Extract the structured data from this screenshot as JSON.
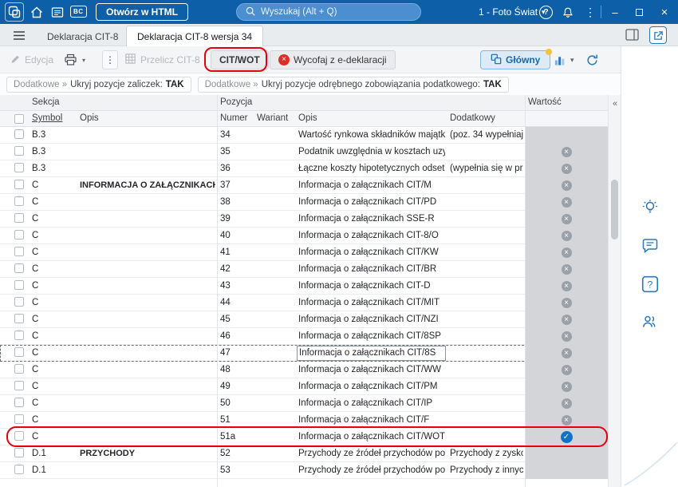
{
  "topbar": {
    "open_html": "Otwórz w HTML",
    "search_placeholder": "Wyszukaj (Alt + Q)",
    "company": "1 - Foto Świat",
    "bc_label": "BC"
  },
  "tabs": {
    "tab1": "Deklaracja CIT-8",
    "tab2": "Deklaracja CIT-8 wersja 34"
  },
  "toolbar": {
    "edit": "Edycja",
    "recalc": "Przelicz CIT-8",
    "citwot": "CIT/WOT",
    "withdraw": "Wycofaj z e-deklaracji",
    "view_main": "Główny"
  },
  "filters": {
    "f1_prefix": "Dodatkowe »",
    "f1_label": "Ukryj pozycje zaliczek:",
    "f1_value": "TAK",
    "f2_prefix": "Dodatkowe »",
    "f2_label": "Ukryj pozycje odrębnego zobowiązania podatkowego:",
    "f2_value": "TAK"
  },
  "icons": {
    "help": "?",
    "more": "⋮",
    "minimize": "–",
    "close": "×",
    "chevron_down": "▾",
    "collapse": "«"
  },
  "grid": {
    "group_sekcja": "Sekcja",
    "group_pozycja": "Pozycja",
    "group_wartosc": "Wartość",
    "col_symbol": "Symbol",
    "col_opis1": "Opis",
    "col_numer": "Numer",
    "col_wariant": "Wariant",
    "col_opis2": "Opis",
    "col_dodatkowy": "Dodatkowy",
    "rows": [
      {
        "symbol": "B.3",
        "sekcja_opis": "",
        "numer": "34",
        "wariant": "",
        "opis": "Wartość rynkowa składników majątk",
        "dodatkowy": "(poz. 34 wypełniaj",
        "value": "blank"
      },
      {
        "symbol": "B.3",
        "sekcja_opis": "",
        "numer": "35",
        "wariant": "",
        "opis": "Podatnik uwzględnia w kosztach uzy",
        "dodatkowy": "",
        "value": "x"
      },
      {
        "symbol": "B.3",
        "sekcja_opis": "",
        "numer": "36",
        "wariant": "",
        "opis": "Łączne koszty hipotetycznych odset",
        "dodatkowy": "(wypełnia się w pr",
        "value": "x"
      },
      {
        "symbol": "C",
        "sekcja_opis": "INFORMACJA O ZAŁĄCZNIKACH",
        "numer": "37",
        "wariant": "",
        "opis": "Informacja o załącznikach CIT/M",
        "dodatkowy": "",
        "value": "x"
      },
      {
        "symbol": "C",
        "sekcja_opis": "",
        "numer": "38",
        "wariant": "",
        "opis": "Informacja o załącznikach CIT/PD",
        "dodatkowy": "",
        "value": "x"
      },
      {
        "symbol": "C",
        "sekcja_opis": "",
        "numer": "39",
        "wariant": "",
        "opis": "Informacja o załącznikach SSE-R",
        "dodatkowy": "",
        "value": "x"
      },
      {
        "symbol": "C",
        "sekcja_opis": "",
        "numer": "40",
        "wariant": "",
        "opis": "Informacja o załącznikach CIT-8/O",
        "dodatkowy": "",
        "value": "x"
      },
      {
        "symbol": "C",
        "sekcja_opis": "",
        "numer": "41",
        "wariant": "",
        "opis": "Informacja o załącznikach CIT/KW",
        "dodatkowy": "",
        "value": "x"
      },
      {
        "symbol": "C",
        "sekcja_opis": "",
        "numer": "42",
        "wariant": "",
        "opis": "Informacja o załącznikach CIT/BR",
        "dodatkowy": "",
        "value": "x"
      },
      {
        "symbol": "C",
        "sekcja_opis": "",
        "numer": "43",
        "wariant": "",
        "opis": "Informacja o załącznikach CIT-D",
        "dodatkowy": "",
        "value": "x"
      },
      {
        "symbol": "C",
        "sekcja_opis": "",
        "numer": "44",
        "wariant": "",
        "opis": "Informacja o załącznikach CIT/MIT",
        "dodatkowy": "",
        "value": "x"
      },
      {
        "symbol": "C",
        "sekcja_opis": "",
        "numer": "45",
        "wariant": "",
        "opis": "Informacja o załącznikach CIT/NZI",
        "dodatkowy": "",
        "value": "x"
      },
      {
        "symbol": "C",
        "sekcja_opis": "",
        "numer": "46",
        "wariant": "",
        "opis": "Informacja o załącznikach CIT/8SP",
        "dodatkowy": "",
        "value": "x"
      },
      {
        "symbol": "C",
        "sekcja_opis": "",
        "numer": "47",
        "wariant": "",
        "opis": "Informacja o załącznikach CIT/8S",
        "dodatkowy": "",
        "value": "x",
        "focused": true
      },
      {
        "symbol": "C",
        "sekcja_opis": "",
        "numer": "48",
        "wariant": "",
        "opis": "Informacja o załącznikach CIT/WW",
        "dodatkowy": "",
        "value": "x"
      },
      {
        "symbol": "C",
        "sekcja_opis": "",
        "numer": "49",
        "wariant": "",
        "opis": "Informacja o załącznikach CIT/PM",
        "dodatkowy": "",
        "value": "x"
      },
      {
        "symbol": "C",
        "sekcja_opis": "",
        "numer": "50",
        "wariant": "",
        "opis": "Informacja o załącznikach CIT/IP",
        "dodatkowy": "",
        "value": "x"
      },
      {
        "symbol": "C",
        "sekcja_opis": "",
        "numer": "51",
        "wariant": "",
        "opis": "Informacja o załącznikach CIT/F",
        "dodatkowy": "",
        "value": "x"
      },
      {
        "symbol": "C",
        "sekcja_opis": "",
        "numer": "51a",
        "wariant": "",
        "opis": "Informacja o załącznikach CIT/WOT",
        "dodatkowy": "",
        "value": "check",
        "annotated": true
      },
      {
        "symbol": "D.1",
        "sekcja_opis": "PRZYCHODY",
        "numer": "52",
        "wariant": "",
        "opis": "Przychody ze źródeł przychodów poł",
        "dodatkowy": "Przychody z zysko",
        "value": "blank"
      },
      {
        "symbol": "D.1",
        "sekcja_opis": "",
        "numer": "53",
        "wariant": "",
        "opis": "Przychody ze źródeł przychodów poł",
        "dodatkowy": "Przychody z innycl",
        "value": "blank"
      }
    ]
  }
}
